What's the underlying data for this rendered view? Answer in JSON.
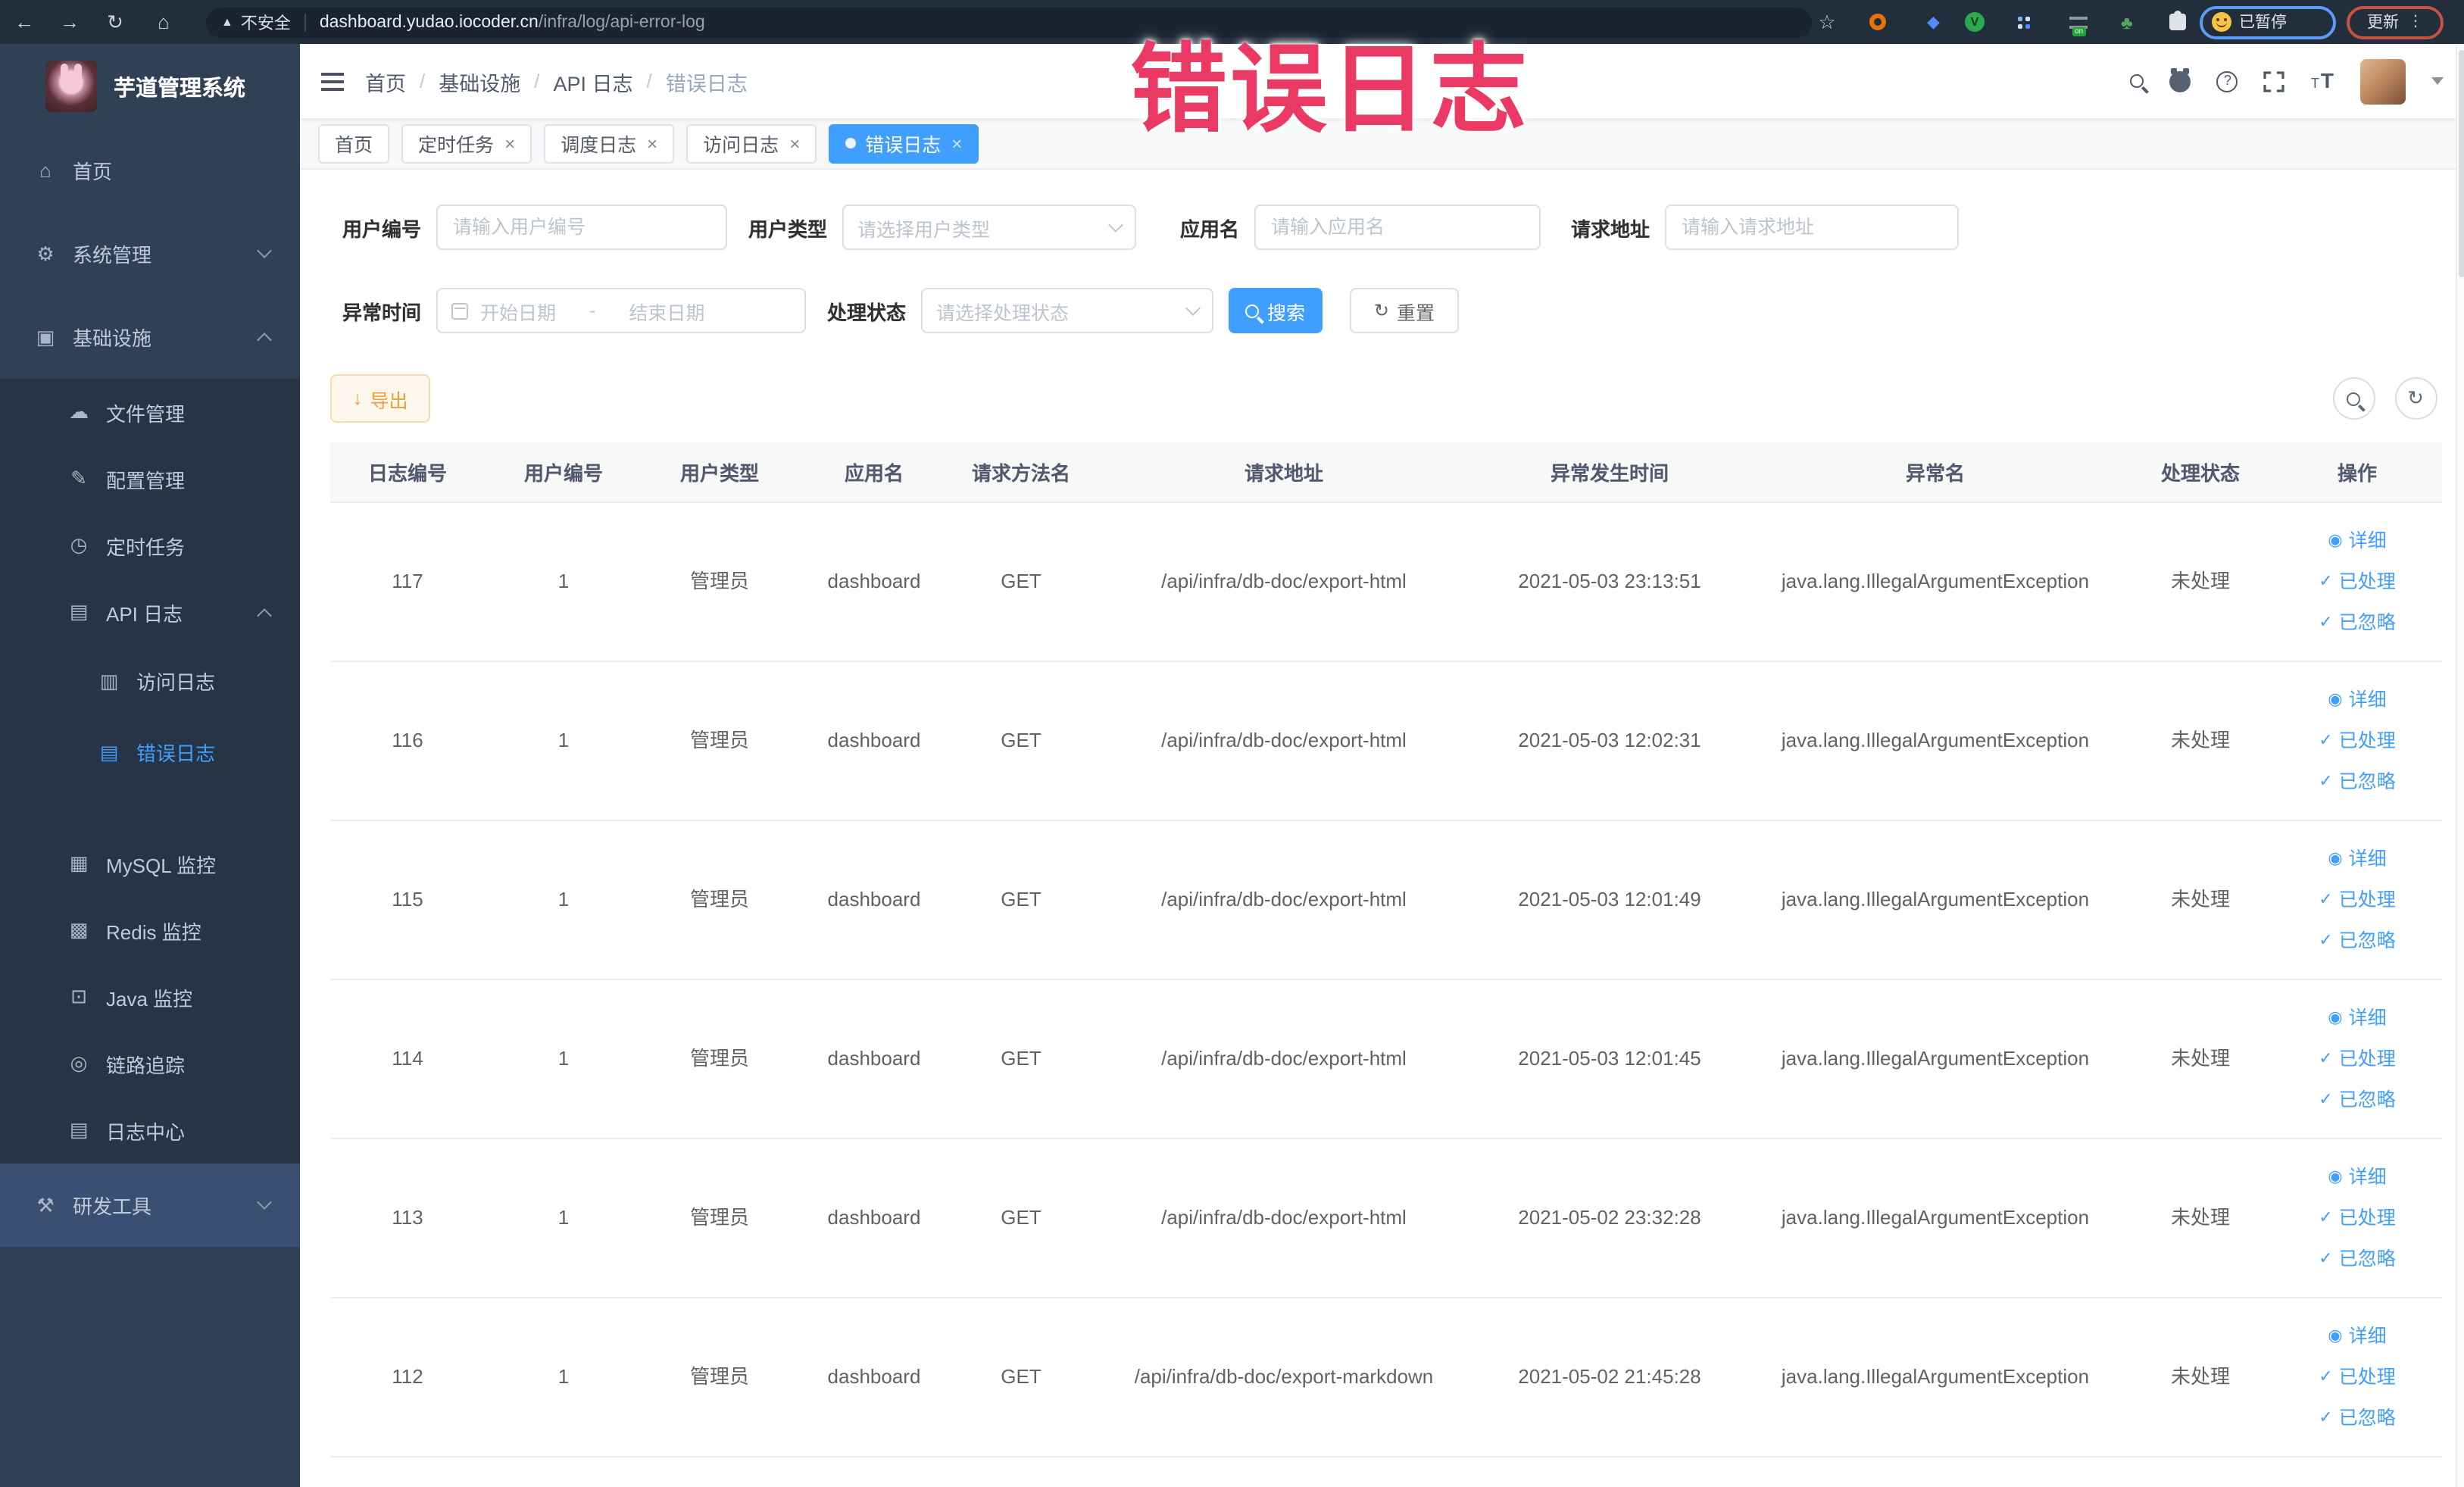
{
  "browser": {
    "security_label": "不安全",
    "url_host": "dashboard.yudao.iocoder.cn",
    "url_path": "/infra/log/api-error-log",
    "paused_badge": "已暂停",
    "update_button": "更新"
  },
  "overlay_title": "错误日志",
  "sidebar": {
    "app_title": "芋道管理系统",
    "items": [
      {
        "label": "首页",
        "icon": "home-icon",
        "level": 0
      },
      {
        "label": "系统管理",
        "icon": "gear-icon",
        "level": 0,
        "chevron": "down"
      },
      {
        "label": "基础设施",
        "icon": "monitor-icon",
        "level": 0,
        "chevron": "up"
      },
      {
        "label": "文件管理",
        "icon": "cloud-upload-icon",
        "level": 1
      },
      {
        "label": "配置管理",
        "icon": "edit-icon",
        "level": 1
      },
      {
        "label": "定时任务",
        "icon": "timer-icon",
        "level": 1
      },
      {
        "label": "API 日志",
        "icon": "api-log-icon",
        "level": 1,
        "chevron": "up"
      },
      {
        "label": "访问日志",
        "icon": "access-log-icon",
        "level": 2
      },
      {
        "label": "错误日志",
        "icon": "error-log-icon",
        "level": 2,
        "active": true
      },
      {
        "label": "MySQL 监控",
        "icon": "mysql-icon",
        "level": 1
      },
      {
        "label": "Redis 监控",
        "icon": "redis-icon",
        "level": 1
      },
      {
        "label": "Java 监控",
        "icon": "java-icon",
        "level": 1
      },
      {
        "label": "链路追踪",
        "icon": "trace-icon",
        "level": 1
      },
      {
        "label": "日志中心",
        "icon": "log-center-icon",
        "level": 1
      },
      {
        "label": "研发工具",
        "icon": "tools-icon",
        "level": 0,
        "chevron": "down",
        "highlight": true
      }
    ]
  },
  "header": {
    "breadcrumb": [
      "首页",
      "基础设施",
      "API 日志",
      "错误日志"
    ]
  },
  "tabs": [
    {
      "label": "首页",
      "closable": false,
      "active": false
    },
    {
      "label": "定时任务",
      "closable": true,
      "active": false
    },
    {
      "label": "调度日志",
      "closable": true,
      "active": false
    },
    {
      "label": "访问日志",
      "closable": true,
      "active": false
    },
    {
      "label": "错误日志",
      "closable": true,
      "active": true
    }
  ],
  "filters": {
    "user_id": {
      "label": "用户编号",
      "placeholder": "请输入用户编号"
    },
    "user_type": {
      "label": "用户类型",
      "placeholder": "请选择用户类型"
    },
    "app_name": {
      "label": "应用名",
      "placeholder": "请输入应用名"
    },
    "request_url": {
      "label": "请求地址",
      "placeholder": "请输入请求地址"
    },
    "exception_time": {
      "label": "异常时间",
      "start_placeholder": "开始日期",
      "separator": "-",
      "end_placeholder": "结束日期"
    },
    "process_status": {
      "label": "处理状态",
      "placeholder": "请选择处理状态"
    },
    "search_button": "搜索",
    "reset_button": "重置"
  },
  "toolbar": {
    "export_button": "导出"
  },
  "table": {
    "columns": [
      "日志编号",
      "用户编号",
      "用户类型",
      "应用名",
      "请求方法名",
      "请求地址",
      "异常发生时间",
      "异常名",
      "处理状态",
      "操作"
    ],
    "actions": [
      "详细",
      "已处理",
      "已忽略"
    ],
    "rows": [
      {
        "id": "117",
        "user_id": "1",
        "user_type": "管理员",
        "app": "dashboard",
        "method": "GET",
        "url": "/api/infra/db-doc/export-html",
        "time": "2021-05-03 23:13:51",
        "exception": "java.lang.IllegalArgumentException",
        "status": "未处理"
      },
      {
        "id": "116",
        "user_id": "1",
        "user_type": "管理员",
        "app": "dashboard",
        "method": "GET",
        "url": "/api/infra/db-doc/export-html",
        "time": "2021-05-03 12:02:31",
        "exception": "java.lang.IllegalArgumentException",
        "status": "未处理"
      },
      {
        "id": "115",
        "user_id": "1",
        "user_type": "管理员",
        "app": "dashboard",
        "method": "GET",
        "url": "/api/infra/db-doc/export-html",
        "time": "2021-05-03 12:01:49",
        "exception": "java.lang.IllegalArgumentException",
        "status": "未处理"
      },
      {
        "id": "114",
        "user_id": "1",
        "user_type": "管理员",
        "app": "dashboard",
        "method": "GET",
        "url": "/api/infra/db-doc/export-html",
        "time": "2021-05-03 12:01:45",
        "exception": "java.lang.IllegalArgumentException",
        "status": "未处理"
      },
      {
        "id": "113",
        "user_id": "1",
        "user_type": "管理员",
        "app": "dashboard",
        "method": "GET",
        "url": "/api/infra/db-doc/export-html",
        "time": "2021-05-02 23:32:28",
        "exception": "java.lang.IllegalArgumentException",
        "status": "未处理"
      },
      {
        "id": "112",
        "user_id": "1",
        "user_type": "管理员",
        "app": "dashboard",
        "method": "GET",
        "url": "/api/infra/db-doc/export-markdown",
        "time": "2021-05-02 21:45:28",
        "exception": "java.lang.IllegalArgumentException",
        "status": "未处理"
      }
    ]
  },
  "colors": {
    "accent": "#409eff",
    "warning_text": "#e6a23c",
    "overlay_pink": "#ea3a63",
    "sidebar_bg": "#304156",
    "submenu_bg": "#263445"
  }
}
